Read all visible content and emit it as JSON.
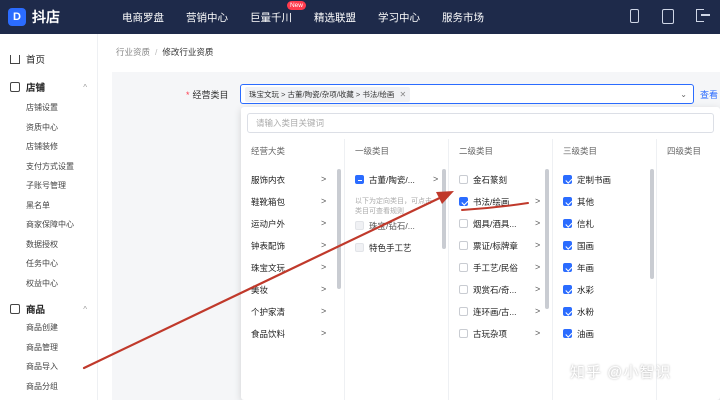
{
  "app": {
    "logo_mark": "D",
    "logo_text": "抖店"
  },
  "nav": [
    {
      "label": "电商罗盘"
    },
    {
      "label": "营销中心"
    },
    {
      "label": "巨量千川",
      "badge": "New"
    },
    {
      "label": "精选联盟"
    },
    {
      "label": "学习中心"
    },
    {
      "label": "服务市场"
    }
  ],
  "top_icons": [
    "phone-icon",
    "tablet-icon",
    "logout-icon"
  ],
  "sidebar": {
    "home": "首页",
    "groups": [
      {
        "title": "店铺",
        "icon": "store-icon",
        "items": [
          "店铺设置",
          "资质中心",
          "店铺装修",
          "支付方式设置",
          "子账号管理",
          "黑名单",
          "商家保障中心",
          "数据授权",
          "任务中心",
          "权益中心"
        ]
      },
      {
        "title": "商品",
        "icon": "goods-icon",
        "items": [
          "商品创建",
          "商品管理",
          "商品导入",
          "商品分组"
        ]
      }
    ]
  },
  "breadcrumb": {
    "parent": "行业资质",
    "separator": "/",
    "current": "修改行业资质"
  },
  "form": {
    "label": "经营类目",
    "required_mark": "*",
    "selected_tag": "珠宝文玩 > 古董/陶瓷/杂项/收藏 > 书法/绘画",
    "view_link": "查看"
  },
  "dropdown": {
    "search_placeholder": "请输入类目关键词",
    "columns": [
      {
        "header": "经营大类",
        "items": [
          "服饰内衣",
          "鞋靴箱包",
          "运动户外",
          "钟表配饰",
          "珠宝文玩",
          "美妆",
          "个护家清",
          "食品饮料"
        ]
      },
      {
        "header": "一级类目",
        "items": [
          {
            "label": "古董/陶瓷/...",
            "state": "indeterminate"
          },
          {
            "label": "珠宝/钻石/...",
            "state": "faded"
          },
          {
            "label": "特色手工艺",
            "state": "faded"
          }
        ],
        "note_line1": "以下为定向类目，可点击",
        "note_line2": "类目可查看规则"
      },
      {
        "header": "二级类目",
        "items": [
          {
            "label": "金石篆刻",
            "state": "unchecked"
          },
          {
            "label": "书法/绘画",
            "state": "checked"
          },
          {
            "label": "烟具/酒具...",
            "state": "unchecked"
          },
          {
            "label": "票证/标牌章",
            "state": "unchecked"
          },
          {
            "label": "手工艺/民俗",
            "state": "unchecked"
          },
          {
            "label": "观赏石/奇...",
            "state": "unchecked"
          },
          {
            "label": "连环画/古...",
            "state": "unchecked"
          },
          {
            "label": "古玩杂项",
            "state": "unchecked"
          }
        ]
      },
      {
        "header": "三级类目",
        "items": [
          {
            "label": "定制书画",
            "state": "checked"
          },
          {
            "label": "其他",
            "state": "checked"
          },
          {
            "label": "信札",
            "state": "checked"
          },
          {
            "label": "国画",
            "state": "checked"
          },
          {
            "label": "年画",
            "state": "checked"
          },
          {
            "label": "水彩",
            "state": "checked"
          },
          {
            "label": "水粉",
            "state": "checked"
          },
          {
            "label": "油画",
            "state": "checked"
          }
        ]
      },
      {
        "header": "四级类目",
        "items": []
      }
    ]
  },
  "watermark": "知乎 @小智识",
  "colors": {
    "topbar": "#1e2a4a",
    "accent": "#2b6cff",
    "annotation_arrow": "#c0392b",
    "badge": "#ff3b4e"
  }
}
